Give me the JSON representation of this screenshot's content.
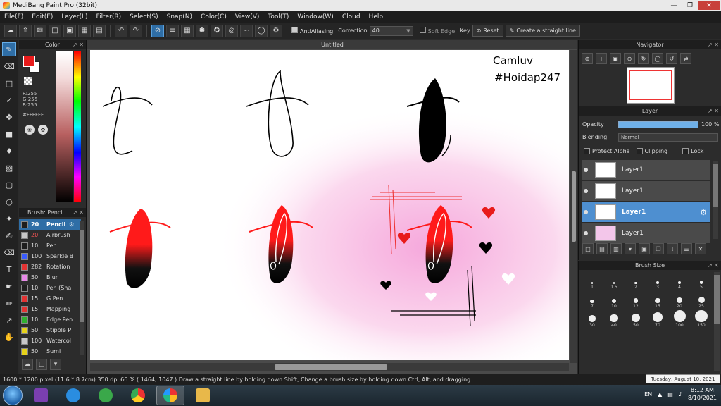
{
  "window": {
    "title": "MediBang Paint Pro (32bit)"
  },
  "menu": [
    "File(F)",
    "Edit(E)",
    "Layer(L)",
    "Filter(R)",
    "Select(S)",
    "Snap(N)",
    "Color(C)",
    "View(V)",
    "Tool(T)",
    "Window(W)",
    "Cloud",
    "Help"
  ],
  "toolbar": {
    "antialiasing_label": "AntiAliasing",
    "correction_label": "Correction",
    "correction_value": "40",
    "soft_edge_label": "Soft Edge",
    "key_label": "Key",
    "reset_label": "Reset",
    "straight_line_label": "Create a straight line"
  },
  "color_panel": {
    "title": "Color",
    "r": "R:255",
    "g": "G:255",
    "b": "B:255",
    "hex": "#FFFFFF",
    "foreground": "#e81b1b"
  },
  "brush_panel": {
    "title": "Brush: Pencil",
    "brushes": [
      {
        "size": "20",
        "name": "Pencil",
        "color": "#1e1e1e",
        "selected": true
      },
      {
        "size": "20",
        "name": "Airbrush",
        "color": "#c8c8c8",
        "size_color": "#ff5555"
      },
      {
        "size": "10",
        "name": "Pen",
        "color": "#1e1e1e"
      },
      {
        "size": "100",
        "name": "Sparkle B",
        "color": "#3a5cff"
      },
      {
        "size": "282",
        "name": "Rotation",
        "color": "#e33333"
      },
      {
        "size": "50",
        "name": "Blur",
        "color": "#e889e8"
      },
      {
        "size": "10",
        "name": "Pen (Sha",
        "color": "#1e1e1e"
      },
      {
        "size": "15",
        "name": "G Pen",
        "color": "#e33333"
      },
      {
        "size": "15",
        "name": "Mapping I",
        "color": "#e33333"
      },
      {
        "size": "10",
        "name": "Edge Pen",
        "color": "#2fb02f"
      },
      {
        "size": "50",
        "name": "Stipple P",
        "color": "#e6d21a"
      },
      {
        "size": "100",
        "name": "Watercol",
        "color": "#c8c8c8"
      },
      {
        "size": "50",
        "name": "Sumi",
        "color": "#e6d21a"
      }
    ]
  },
  "canvas": {
    "tab_title": "Untitled",
    "watermark_line1": "Camluv",
    "watermark_line2": "#Hoidap247"
  },
  "navigator": {
    "title": "Navigator"
  },
  "layer_panel": {
    "title": "Layer",
    "opacity_label": "Opacity",
    "opacity_value": "100 %",
    "opacity": 1.0,
    "blending_label": "Blending",
    "blending_value": "Normal",
    "protect_alpha_label": "Protect Alpha",
    "clipping_label": "Clipping",
    "lock_label": "Lock",
    "layers": [
      {
        "name": "Layer1",
        "selected": false
      },
      {
        "name": "Layer1",
        "selected": false
      },
      {
        "name": "Layer1",
        "selected": true
      },
      {
        "name": "Layer1",
        "selected": false
      }
    ]
  },
  "brush_size_panel": {
    "title": "Brush Size",
    "sizes": [
      "1",
      "1.5",
      "2",
      "3",
      "4",
      "5",
      "7",
      "10",
      "12",
      "15",
      "20",
      "25",
      "30",
      "40",
      "50",
      "70",
      "100",
      "150"
    ]
  },
  "status": {
    "text": "1600 * 1200 pixel  (11.6 * 8.7cm)  350 dpi  66 %  ( 1464, 1047 )  Draw a straight line by holding down Shift, Change a brush size by holding down Ctrl, Alt, and dragging",
    "tooltip": "Tuesday, August 10, 2021"
  },
  "taskbar": {
    "lang": "EN",
    "time": "8:12 AM",
    "date": "8/10/2021"
  }
}
